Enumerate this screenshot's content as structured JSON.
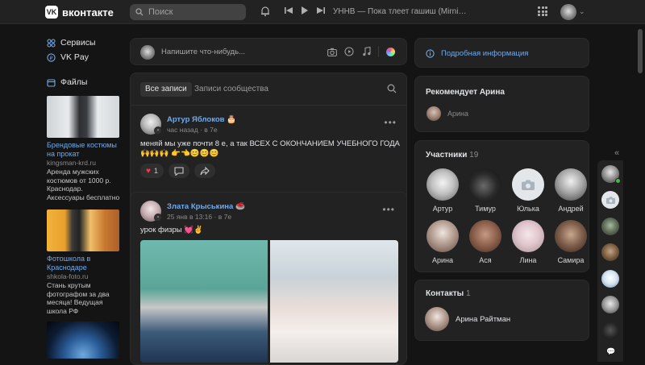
{
  "topbar": {
    "logo_mark": "VK",
    "logo_text": "вконтакте",
    "search_placeholder": "Поиск",
    "now_playing": "УННВ — Пока тлеет гашиш (Mirniyy Ed..."
  },
  "leftnav": {
    "items": [
      {
        "label": "Сервисы",
        "icon": "services-icon"
      },
      {
        "label": "VK Pay",
        "icon": "vkpay-icon"
      },
      {
        "label": "Файлы",
        "icon": "files-icon"
      }
    ],
    "ads": [
      {
        "title": "Брендовые костюмы на прокат",
        "domain": "kingsman-krd.ru",
        "text": "Аренда мужских костюмов от 1000 р. Краснодар. Аксессуары бесплатно"
      },
      {
        "title": "Фотошкола в Краснодаре",
        "domain": "shkola-foto.ru",
        "text": "Стань крутым фотографом за два месяца! Ведущая школа РФ"
      }
    ]
  },
  "compose": {
    "placeholder": "Напишите что-нибудь..."
  },
  "feed": {
    "tabs": [
      "Все записи",
      "Записи сообщества"
    ],
    "posts": [
      {
        "author": "Артур Яблоков",
        "emoji": "🎂",
        "time": "час назад",
        "source": "в 7е",
        "text": "меняй мы уже почти 8 е, а так ВСЕХ С ОКОНЧАНИЕМ УЧЕБНОГО ГОДА 🙌🙌🙌 👉👈😊😊😊",
        "likes": "1"
      },
      {
        "author": "Злата Крыськина",
        "emoji": "🥌",
        "time": "25 янв в 13:16",
        "source": "в 7е",
        "text": "урок физры 💓✌️"
      }
    ]
  },
  "right": {
    "info_label": "Подробная информация",
    "recommends_title": "Рекомендует Арина",
    "recommends_name": "Арина",
    "members_title": "Участники",
    "members_count": "19",
    "members": [
      "Артур",
      "Тимур",
      "Юлька",
      "Андрей",
      "Арина",
      "Ася",
      "Лина",
      "Самира"
    ],
    "contacts_title": "Контакты",
    "contacts_count": "1",
    "contact_name": "Арина Райтман"
  },
  "colors": {
    "accent": "#71aaeb",
    "background": "#141414",
    "card": "#222222",
    "like": "#ff3347"
  }
}
